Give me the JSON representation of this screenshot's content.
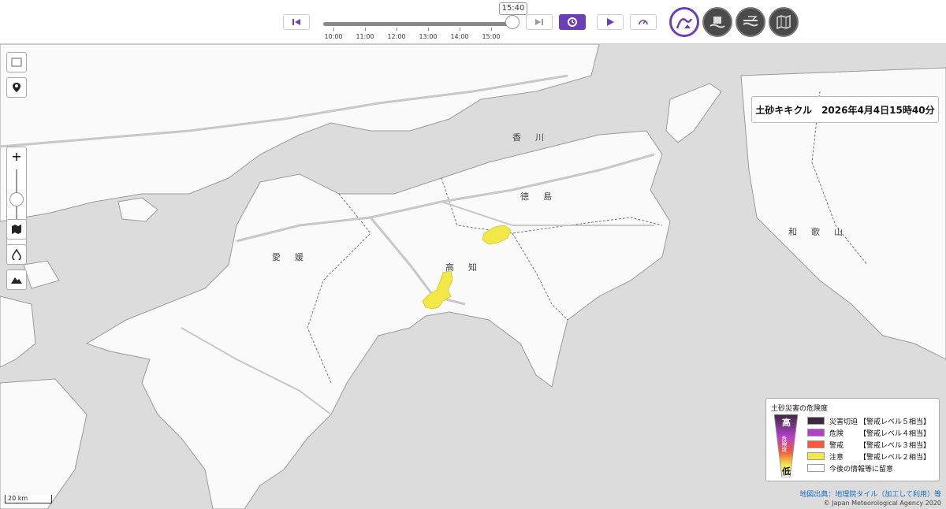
{
  "timeline": {
    "current_time": "15:40",
    "ticks": [
      "10:00",
      "11:00",
      "12:00",
      "13:00",
      "14:00",
      "15:00"
    ],
    "position": 1.0
  },
  "controls": {
    "first_icon": "skip-to-start-icon",
    "last_icon": "skip-to-end-icon",
    "latest_icon": "refresh-latest-icon",
    "play_icon": "play-icon",
    "speed_icon": "speed-gauge-icon"
  },
  "layers": [
    {
      "icon": "landslide-risk-icon",
      "selected": true
    },
    {
      "icon": "inundation-risk-icon",
      "selected": false
    },
    {
      "icon": "flood-risk-icon",
      "selected": false
    },
    {
      "icon": "map-layer-icon",
      "selected": false
    }
  ],
  "map_controls": {
    "zoom_in": "+",
    "zoom_out": "−"
  },
  "title": {
    "product": "土砂キキクル",
    "datetime": "2026年4月4日15時40分"
  },
  "map_labels": {
    "kagawa": "香川",
    "tokushima": "徳島",
    "ehime": "愛媛",
    "kochi": "高知",
    "wakayama": "和歌山"
  },
  "legend": {
    "title": "土砂災害の危険度",
    "high": "高",
    "middle": "危険度",
    "low": "低",
    "items": [
      {
        "name": "災害切迫",
        "level": "【警戒レベル５相当】",
        "color": "#3d2a3f"
      },
      {
        "name": "危険",
        "level": "【警戒レベル４相当】",
        "color": "#b33fc9"
      },
      {
        "name": "警戒",
        "level": "【警戒レベル３相当】",
        "color": "#f25c3a"
      },
      {
        "name": "注意",
        "level": "【警戒レベル２相当】",
        "color": "#f2e84a"
      },
      {
        "name": "今後の情報等に留意",
        "level": "",
        "color": "#ffffff"
      }
    ]
  },
  "scale_bar": "20 km",
  "credits": {
    "source": "地図出典：地理院タイル（加工して利用）等",
    "copyright": "© Japan Meteorological Agency 2020"
  },
  "colors": {
    "accent": "#6b3fb8",
    "warning_yellow": "#f2e84a",
    "land": "#ffffff",
    "sea": "#dcdcdc"
  }
}
